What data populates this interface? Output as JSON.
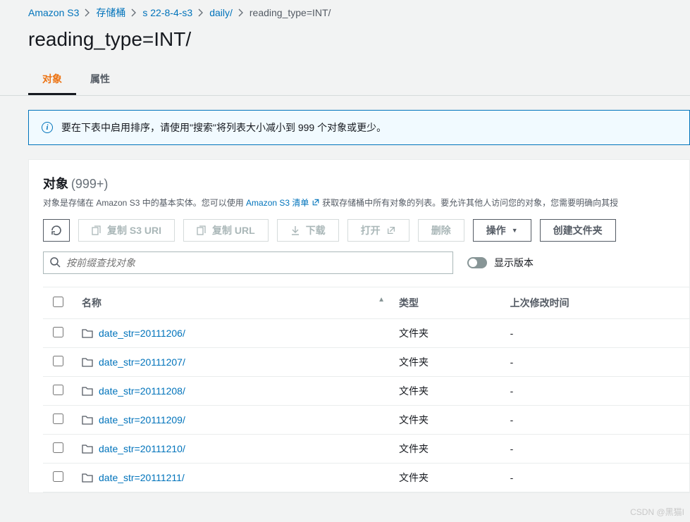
{
  "breadcrumb": [
    {
      "label": "Amazon S3"
    },
    {
      "label": "存储桶"
    },
    {
      "label": "s              22-8-4-s3"
    },
    {
      "label": "daily/"
    },
    {
      "label": "reading_type=INT/",
      "current": true
    }
  ],
  "page_title": "reading_type=INT/",
  "tabs": {
    "objects": "对象",
    "properties": "属性"
  },
  "info_banner": "要在下表中启用排序，请使用\"搜索\"将列表大小减小到 999 个对象或更少。",
  "section": {
    "title": "对象",
    "count": "(999+)",
    "desc_before": "对象是存储在 Amazon S3 中的基本实体。您可以使用 ",
    "desc_link": "Amazon S3 清单",
    "desc_after": "获取存储桶中所有对象的列表。要允许其他人访问您的对象，您需要明确向其授"
  },
  "toolbar": {
    "copy_s3_uri": "复制 S3 URI",
    "copy_url": "复制 URL",
    "download": "下载",
    "open": "打开",
    "delete": "删除",
    "actions": "操作",
    "create_folder": "创建文件夹"
  },
  "search": {
    "placeholder": "按前缀查找对象"
  },
  "toggle_label": "显示版本",
  "columns": {
    "name": "名称",
    "type": "类型",
    "modified": "上次修改时间"
  },
  "rows": [
    {
      "name": "date_str=20111206/",
      "type": "文件夹",
      "modified": "-"
    },
    {
      "name": "date_str=20111207/",
      "type": "文件夹",
      "modified": "-"
    },
    {
      "name": "date_str=20111208/",
      "type": "文件夹",
      "modified": "-"
    },
    {
      "name": "date_str=20111209/",
      "type": "文件夹",
      "modified": "-"
    },
    {
      "name": "date_str=20111210/",
      "type": "文件夹",
      "modified": "-"
    },
    {
      "name": "date_str=20111211/",
      "type": "文件夹",
      "modified": "-"
    }
  ],
  "watermark": "CSDN @黑猫I"
}
